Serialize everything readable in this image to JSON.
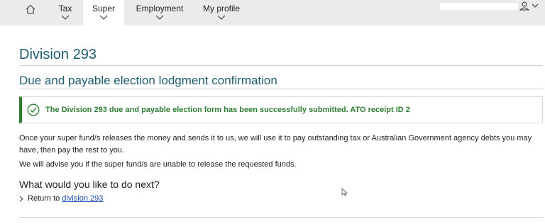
{
  "nav": {
    "items": [
      {
        "label": "Tax"
      },
      {
        "label": "Super"
      },
      {
        "label": "Employment"
      },
      {
        "label": "My profile"
      }
    ],
    "active": "Super",
    "icons": [
      "home-icon",
      "chevron-down-icon",
      "user-icon"
    ]
  },
  "page": {
    "title": "Division 293",
    "section_title": "Due and payable election lodgment confirmation"
  },
  "success": {
    "message": "The Division 293 due and payable election form has been successfully submitted. ATO receipt ID 2",
    "icon": "check-circle-icon",
    "color": "#2e7d32"
  },
  "body": {
    "para1": "Once your super fund/s releases the money and sends it to us, we will use it to pay outstanding tax or Australian Government agency debts you may have, then pay the rest to you.",
    "para2": "We will advise you if the super fund/s are unable to release the requested funds."
  },
  "next": {
    "heading": "What would you like to do next?",
    "return_prefix": "Return to",
    "return_link": "division 293"
  },
  "colors": {
    "heading": "#1f5d6e",
    "link": "#1a4fb3",
    "nav_bg": "#ebebeb"
  }
}
